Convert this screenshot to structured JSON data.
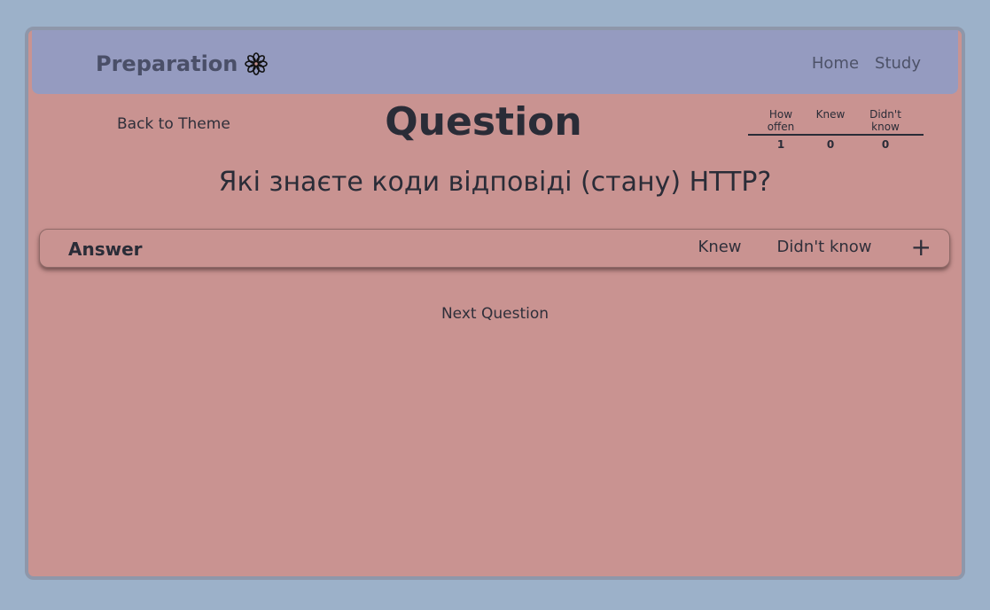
{
  "navbar": {
    "brand": "Preparation",
    "links": [
      "Home",
      "Study"
    ]
  },
  "back_link": "Back to Theme",
  "page_title": "Question",
  "stats": {
    "headers": [
      "How offen",
      "Knew",
      "Didn't know"
    ],
    "values": [
      "1",
      "0",
      "0"
    ]
  },
  "question_text": "Які знаєте коди відповіді (стану) HTTP?",
  "answer": {
    "title": "Answer",
    "knew_label": "Knew",
    "didnt_know_label": "Didn't know",
    "expand_icon": "+"
  },
  "next_question": "Next Question",
  "colors": {
    "background": "#9cb1c9",
    "navbar": "#959bc0",
    "card": "#c99391",
    "text": "#2a2c37"
  }
}
